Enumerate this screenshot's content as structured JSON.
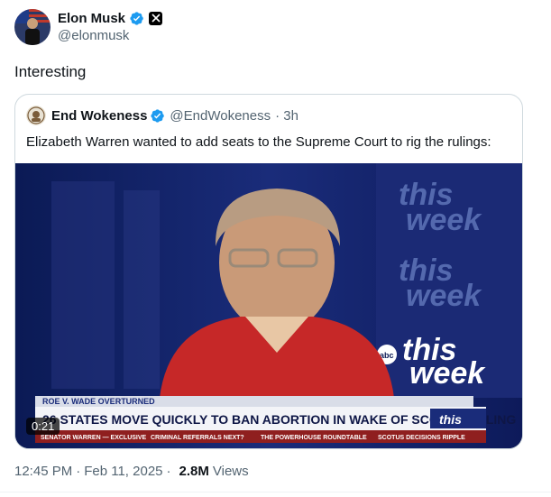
{
  "author": {
    "name": "Elon Musk",
    "handle": "@elonmusk"
  },
  "tweet": {
    "text": "Interesting"
  },
  "quote": {
    "name": "End Wokeness",
    "handle": "@EndWokeness",
    "time": "· 3h",
    "text": "Elizabeth Warren wanted to add seats to the Supreme Court to rig the rulings:"
  },
  "video": {
    "duration": "0:21",
    "brand_lines": [
      "this",
      "week"
    ],
    "brand_small": "abc",
    "lower_third_header": "ROE V. WADE OVERTURNED",
    "lower_third_headline": "26 STATES MOVE QUICKLY TO BAN ABORTION IN WAKE OF SCOTUS RULING",
    "ticker": [
      "SENATOR WARREN — EXCLUSIVE",
      "CRIMINAL REFERRALS NEXT?",
      "THE POWERHOUSE ROUNDTABLE",
      "SCOTUS DECISIONS RIPPLE"
    ]
  },
  "meta": {
    "time": "12:45 PM",
    "date": "Feb 11, 2025",
    "views": "2.8M",
    "views_label": "Views"
  },
  "colors": {
    "verified": "#1d9bf0",
    "muted": "#536471",
    "video_bg": "#0e1646",
    "lower_third_red": "#c0392b"
  },
  "icons": [
    "verified-badge-icon",
    "x-logo-icon"
  ]
}
